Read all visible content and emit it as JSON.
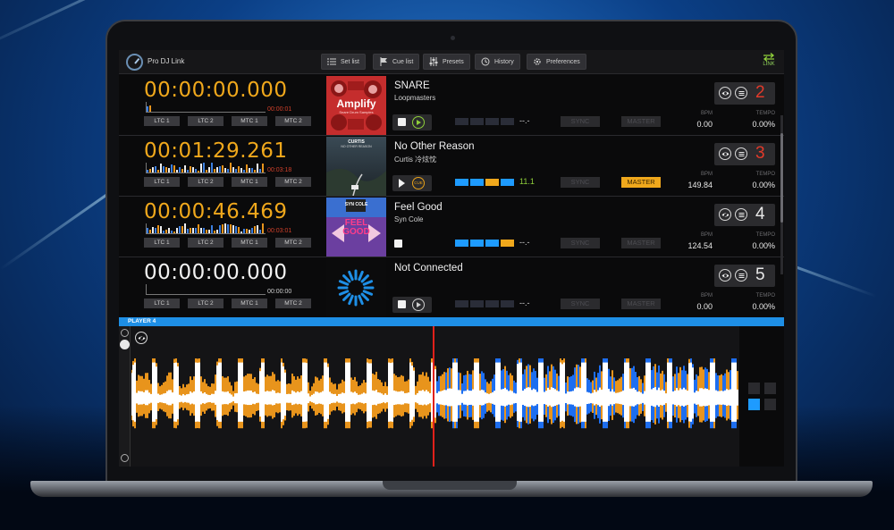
{
  "app": {
    "title": "Pro DJ Link",
    "link_label": "LINK"
  },
  "toolbar": {
    "buttons": [
      {
        "label": "Set list",
        "icon": "list-icon"
      },
      {
        "label": "Cue list",
        "icon": "flag-icon"
      },
      {
        "label": "Presets",
        "icon": "sliders-icon"
      },
      {
        "label": "History",
        "icon": "history-icon"
      },
      {
        "label": "Preferences",
        "icon": "gear-icon"
      }
    ]
  },
  "labels": {
    "ltc1": "LTC 1",
    "ltc2": "LTC 2",
    "mtc1": "MTC 1",
    "mtc2": "MTC 2",
    "sync": "SYNC",
    "master": "MASTER",
    "bpm": "BPM",
    "tempo": "TEMPO"
  },
  "decks": [
    {
      "timecode": "00:00:00.000",
      "timecode_color": "#f0a81c",
      "remaining": "00:00:01",
      "remaining_color": "#d0402a",
      "title": "SNARE",
      "artist": "Loopmasters",
      "art_text": "Amplify",
      "art_subtext": "Snare Drum Samples",
      "beat_counter": "--.-",
      "bpm": "0.00",
      "tempo": "0.00%",
      "player_number": "2",
      "player_color": "#e23a2a",
      "playing": true,
      "master_active": false,
      "beats": [
        0,
        0,
        0,
        0
      ]
    },
    {
      "timecode": "00:01:29.261",
      "timecode_color": "#f0a81c",
      "remaining": "00:03:18",
      "remaining_color": "#d0402a",
      "title": "No Other Reason",
      "artist": "Curtis 冷炫忱",
      "art_text": "CURTIS",
      "art_subtext": "NO OTHER REASON",
      "beat_counter": "11.1",
      "bpm": "149.84",
      "tempo": "0.00%",
      "player_number": "3",
      "player_color": "#e23a2a",
      "playing": false,
      "master_active": true,
      "beats": [
        1,
        1,
        2,
        1
      ]
    },
    {
      "timecode": "00:00:46.469",
      "timecode_color": "#f0a81c",
      "remaining": "00:03:01",
      "remaining_color": "#d0402a",
      "title": "Feel Good",
      "artist": "Syn Cole",
      "art_text": "FEEL GOOD",
      "art_subtext": "SYN COLE",
      "beat_counter": "--.-",
      "bpm": "124.54",
      "tempo": "0.00%",
      "player_number": "4",
      "player_color": "#e8e8e8",
      "playing": false,
      "master_active": false,
      "beats": [
        1,
        1,
        1,
        2
      ]
    },
    {
      "timecode": "00:00:00.000",
      "timecode_color": "#f2f2f2",
      "remaining": "00:00:00",
      "remaining_color": "#cfcfcf",
      "title": "Not Connected",
      "artist": "",
      "art_text": "",
      "art_subtext": "",
      "beat_counter": "--.-",
      "bpm": "0.00",
      "tempo": "0.00%",
      "player_number": "5",
      "player_color": "#e8e8e8",
      "playing": false,
      "master_active": false,
      "beats": [
        0,
        0,
        0,
        0
      ]
    }
  ],
  "player_panel": {
    "label": "PLAYER 4",
    "playhead_fraction": 0.5,
    "colors": {
      "orange": "#e8941c",
      "blue": "#1d6ef0",
      "white": "#ffffff",
      "playhead": "#e0201a"
    }
  }
}
